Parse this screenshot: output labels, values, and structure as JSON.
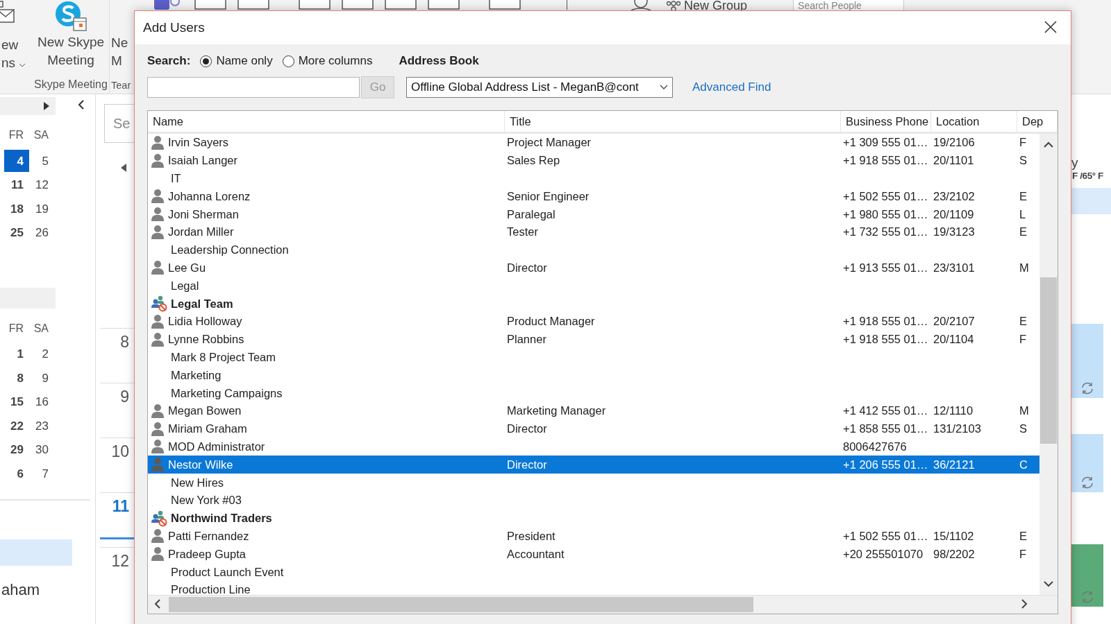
{
  "ribbon": {
    "partial_button": {
      "line_1": "ew",
      "line_2": "ns"
    },
    "skype_button": {
      "label": "New Skype Meeting"
    },
    "teams_button": {
      "line_1": "Ne",
      "line_2": "M"
    },
    "groups": [
      "Skype Meeting",
      "Tear"
    ],
    "new_group": "New Group",
    "search_people": {
      "placeholder": "Search People"
    }
  },
  "mini_calendars": [
    {
      "headers": [
        "FR",
        "SA"
      ],
      "weeks": [
        [
          {
            "day": "4",
            "selected": true
          },
          {
            "day": "5",
            "selected": false
          }
        ],
        [
          {
            "day": "11",
            "selected": false
          },
          {
            "day": "12",
            "selected": false
          }
        ],
        [
          {
            "day": "18",
            "selected": false
          },
          {
            "day": "19",
            "selected": false
          }
        ],
        [
          {
            "day": "25",
            "selected": false
          },
          {
            "day": "26",
            "selected": false
          }
        ]
      ]
    },
    {
      "headers": [
        "FR",
        "SA"
      ],
      "weeks": [
        [
          {
            "day": "1",
            "selected": false
          },
          {
            "day": "2",
            "selected": false
          }
        ],
        [
          {
            "day": "8",
            "selected": false
          },
          {
            "day": "9",
            "selected": false
          }
        ],
        [
          {
            "day": "15",
            "selected": false
          },
          {
            "day": "16",
            "selected": false
          }
        ],
        [
          {
            "day": "22",
            "selected": false
          },
          {
            "day": "23",
            "selected": false
          }
        ],
        [
          {
            "day": "29",
            "selected": false
          },
          {
            "day": "30",
            "selected": false
          }
        ],
        [
          {
            "day": "6",
            "selected": false
          },
          {
            "day": "7",
            "selected": false
          }
        ]
      ]
    }
  ],
  "folder_item": "aham",
  "calendar_view": {
    "search": {
      "placeholder": "Se"
    },
    "hours": [
      {
        "label": "8",
        "current": false
      },
      {
        "label": "9",
        "current": false
      },
      {
        "label": "10",
        "current": false
      },
      {
        "label": "11",
        "current": true
      },
      {
        "label": "12",
        "current": false
      }
    ]
  },
  "right_pane": {
    "line_1": "y",
    "line_2": "F /65° F"
  },
  "dialog": {
    "title": "Add Users",
    "search_label": "Search:",
    "search_modes": [
      {
        "label": "Name only",
        "selected": true
      },
      {
        "label": "More columns",
        "selected": false
      }
    ],
    "address_book_label": "Address Book",
    "go_button": {
      "label": "Go",
      "disabled": true
    },
    "address_book": {
      "value": "Offline Global Address List - MeganB@cont"
    },
    "advanced_find": "Advanced Find",
    "table": {
      "columns": [
        "Name",
        "Title",
        "Business Phone",
        "Location",
        "Dep"
      ],
      "rows": [
        {
          "kind": "person",
          "name": "Irvin Sayers",
          "title": "Project Manager",
          "phone": "+1 309 555 01…",
          "location": "19/2106",
          "dep": "F",
          "selected": false
        },
        {
          "kind": "person",
          "name": "Isaiah Langer",
          "title": "Sales Rep",
          "phone": "+1 918 555 01…",
          "location": "20/1101",
          "dep": "S",
          "selected": false
        },
        {
          "kind": "none",
          "name": "IT",
          "selected": false
        },
        {
          "kind": "person",
          "name": "Johanna Lorenz",
          "title": "Senior Engineer",
          "phone": "+1 502 555 01…",
          "location": "23/2102",
          "dep": "E",
          "selected": false
        },
        {
          "kind": "person",
          "name": "Joni Sherman",
          "title": "Paralegal",
          "phone": "+1 980 555 01…",
          "location": "20/1109",
          "dep": "L",
          "selected": false
        },
        {
          "kind": "person",
          "name": "Jordan Miller",
          "title": "Tester",
          "phone": "+1 732 555 01…",
          "location": "19/3123",
          "dep": "E",
          "selected": false
        },
        {
          "kind": "none",
          "name": "Leadership Connection",
          "selected": false
        },
        {
          "kind": "person",
          "name": "Lee Gu",
          "title": "Director",
          "phone": "+1 913 555 01…",
          "location": "23/3101",
          "dep": "M",
          "selected": false
        },
        {
          "kind": "none",
          "name": "Legal",
          "selected": false
        },
        {
          "kind": "group",
          "name": "Legal Team",
          "selected": false
        },
        {
          "kind": "person",
          "name": "Lidia Holloway",
          "title": "Product Manager",
          "phone": "+1 918 555 01…",
          "location": "20/2107",
          "dep": "E",
          "selected": false
        },
        {
          "kind": "person",
          "name": "Lynne Robbins",
          "title": "Planner",
          "phone": "+1 918 555 01…",
          "location": "20/1104",
          "dep": "F",
          "selected": false
        },
        {
          "kind": "none",
          "name": "Mark 8 Project Team",
          "selected": false
        },
        {
          "kind": "none",
          "name": "Marketing",
          "selected": false
        },
        {
          "kind": "none",
          "name": "Marketing Campaigns",
          "selected": false
        },
        {
          "kind": "person",
          "name": "Megan Bowen",
          "title": "Marketing Manager",
          "phone": "+1 412 555 01…",
          "location": "12/1110",
          "dep": "M",
          "selected": false
        },
        {
          "kind": "person",
          "name": "Miriam Graham",
          "title": "Director",
          "phone": "+1 858 555 01…",
          "location": "131/2103",
          "dep": "S",
          "selected": false
        },
        {
          "kind": "person",
          "name": "MOD Administrator",
          "phone": "8006427676",
          "selected": false
        },
        {
          "kind": "person",
          "name": "Nestor Wilke",
          "title": "Director",
          "phone": "+1 206 555 01…",
          "location": "36/2121",
          "dep": "C",
          "selected": true
        },
        {
          "kind": "none",
          "name": "New Hires",
          "selected": false
        },
        {
          "kind": "none",
          "name": "New York #03",
          "selected": false
        },
        {
          "kind": "group",
          "name": "Northwind Traders",
          "selected": false
        },
        {
          "kind": "person",
          "name": "Patti Fernandez",
          "title": "President",
          "phone": "+1 502 555 01…",
          "location": "15/1102",
          "dep": "E",
          "selected": false
        },
        {
          "kind": "person",
          "name": "Pradeep Gupta",
          "title": "Accountant",
          "phone": "+20 255501070",
          "location": "98/2202",
          "dep": "F",
          "selected": false
        },
        {
          "kind": "none",
          "name": "Product Launch Event",
          "selected": false
        },
        {
          "kind": "none",
          "name": "Production Line",
          "selected": false
        }
      ]
    }
  }
}
